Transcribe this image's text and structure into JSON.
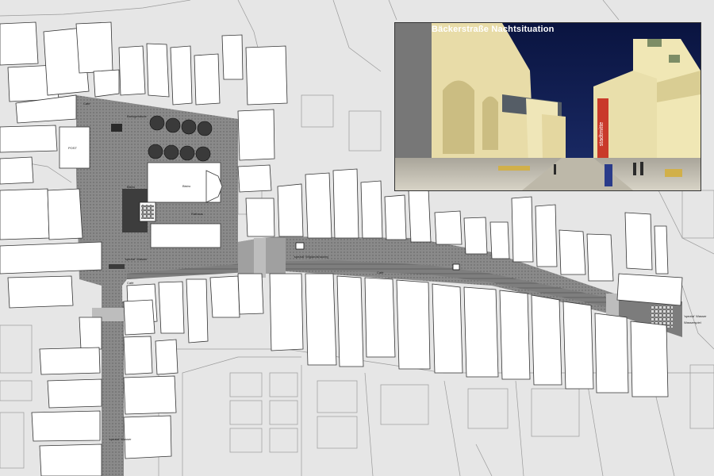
{
  "inset": {
    "title": "Bäckerstraße Nachtsituation",
    "sign_text": "stadtmitte"
  },
  "map_labels": {
    "cafe_1": "Café",
    "label_2": "Bankgebäude",
    "label_3": "Bistro",
    "label_4": "Rathaus",
    "label_5": "POST",
    "label_6": "Bistro",
    "label_7": "'spezial' Wasser",
    "cafe_2": "Café",
    "label_9": "'spezial' Wiglandshauteg",
    "cafe_3": "Café",
    "label_11": "'spezial' Wasser",
    "label_12": "'spezial' Wasser",
    "label_13": "Wasserspiel"
  },
  "colors": {
    "street": "#8c8c8c",
    "building": "#ffffff",
    "background": "#e6e6e6",
    "night_sky": "#0f1b48",
    "facade": "#e6d9a8"
  }
}
